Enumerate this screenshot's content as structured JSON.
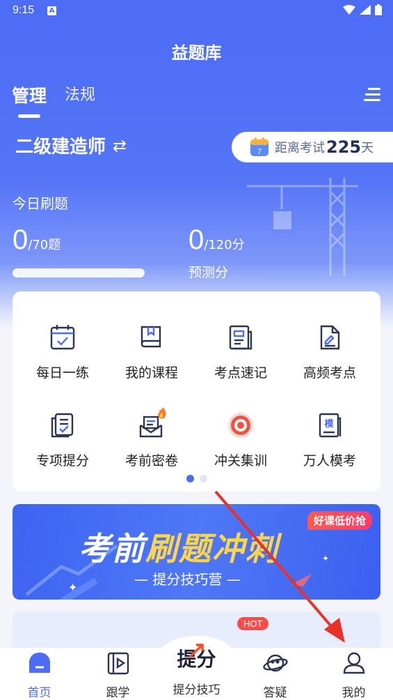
{
  "status": {
    "time": "9:15",
    "notif_letter": "A"
  },
  "app_title": "益题库",
  "tabs": [
    {
      "label": "管理",
      "active": true
    },
    {
      "label": "法规",
      "active": false
    }
  ],
  "certificate": {
    "name": "二级建造师",
    "switch_symbol": "⇄"
  },
  "countdown": {
    "calendar_day": "7",
    "prefix": "距离考试",
    "days": "225",
    "suffix": "天"
  },
  "today": {
    "label": "今日刷题",
    "done_count": "0",
    "total_text": "/70题",
    "progress": 0,
    "score": "0",
    "score_total_text": "/120分",
    "predict_label": "预测分"
  },
  "features": [
    {
      "label": "每日一练",
      "icon": "calendar-check-icon"
    },
    {
      "label": "我的课程",
      "icon": "book-icon"
    },
    {
      "label": "考点速记",
      "icon": "notes-icon"
    },
    {
      "label": "高频考点",
      "icon": "document-edit-icon"
    },
    {
      "label": "专项提分",
      "icon": "checklist-icon"
    },
    {
      "label": "考前密卷",
      "icon": "mail-paper-fire-icon"
    },
    {
      "label": "冲关集训",
      "icon": "target-icon"
    },
    {
      "label": "万人模考",
      "icon": "mock-exam-icon",
      "icon_char": "模"
    }
  ],
  "pager": {
    "pages": 2,
    "current": 0
  },
  "banner": {
    "title_white": "考前",
    "title_yellow": "刷题冲刺",
    "subtitle": "— 提分技巧营 —",
    "badge": "好课低价抢"
  },
  "peek": {
    "hot_badge": "HOT"
  },
  "bottom_nav": [
    {
      "label": "首页",
      "icon": "home-icon",
      "active": true
    },
    {
      "label": "跟学",
      "icon": "video-book-icon",
      "active": false
    },
    {
      "label": "提分技巧",
      "icon": "logo-tifen",
      "logo_text": "提分",
      "active": false
    },
    {
      "label": "答疑",
      "icon": "planet-icon",
      "active": false
    },
    {
      "label": "我的",
      "icon": "user-icon",
      "active": false
    }
  ],
  "colors": {
    "primary": "#4c6cf6",
    "annotation_arrow": "#e8312b",
    "hot": "#ff4b4b"
  }
}
